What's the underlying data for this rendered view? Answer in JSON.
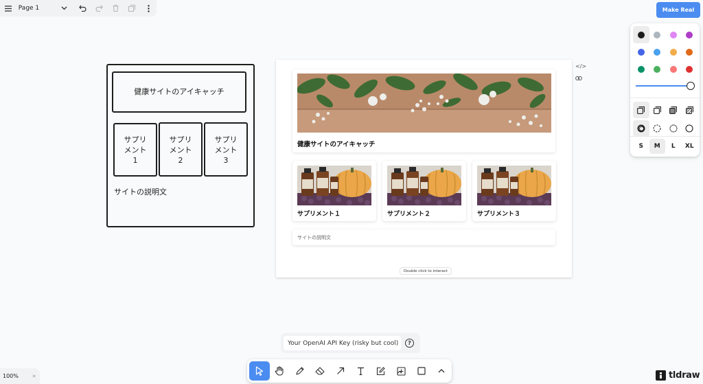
{
  "page_menu": {
    "title": "Page 1"
  },
  "make_real": {
    "label": "Make Real"
  },
  "style_panel": {
    "colors": [
      "#1d1d1d",
      "#adb5bd",
      "#e085f4",
      "#ae3ec9",
      "#4465e9",
      "#4ba1f1",
      "#f1ac4b",
      "#e16919",
      "#099268",
      "#4cb05e",
      "#f87777",
      "#e03131"
    ],
    "selected_color": "#1d1d1d",
    "opacity": 1.0,
    "fill_options": [
      "fill-none-icon",
      "fill-semi-icon",
      "fill-solid-icon",
      "fill-pattern-icon"
    ],
    "dash_options": [
      "dash-draw-icon",
      "dash-dashed-icon",
      "dash-dotted-icon",
      "dash-solid-icon"
    ],
    "sizes": [
      "S",
      "M",
      "L",
      "XL"
    ],
    "selected_size": "M"
  },
  "wireframe": {
    "header": "健康サイトのアイキャッチ",
    "items": [
      {
        "line1": "サプリ",
        "line2": "メント",
        "line3": "1"
      },
      {
        "line1": "サプリ",
        "line2": "メント",
        "line3": "2"
      },
      {
        "line1": "サプリ",
        "line2": "メント",
        "line3": "3"
      }
    ],
    "description": "サイトの説明文"
  },
  "preview": {
    "hero_title": "健康サイトのアイキャッチ",
    "products": [
      "サプリメント１",
      "サプリメント２",
      "サプリメント３"
    ],
    "description": "サイトの説明文",
    "interact_hint": "Double click to interact"
  },
  "api_key": {
    "placeholder": "Your OpenAI API Key (risky but cool)",
    "help_label": "?"
  },
  "toolbar": {
    "tools": [
      "select",
      "hand",
      "draw",
      "eraser",
      "arrow",
      "text",
      "note",
      "asset",
      "rectangle",
      "more"
    ]
  },
  "zoom": {
    "level": "100%"
  },
  "brand": {
    "name": "tldraw"
  }
}
